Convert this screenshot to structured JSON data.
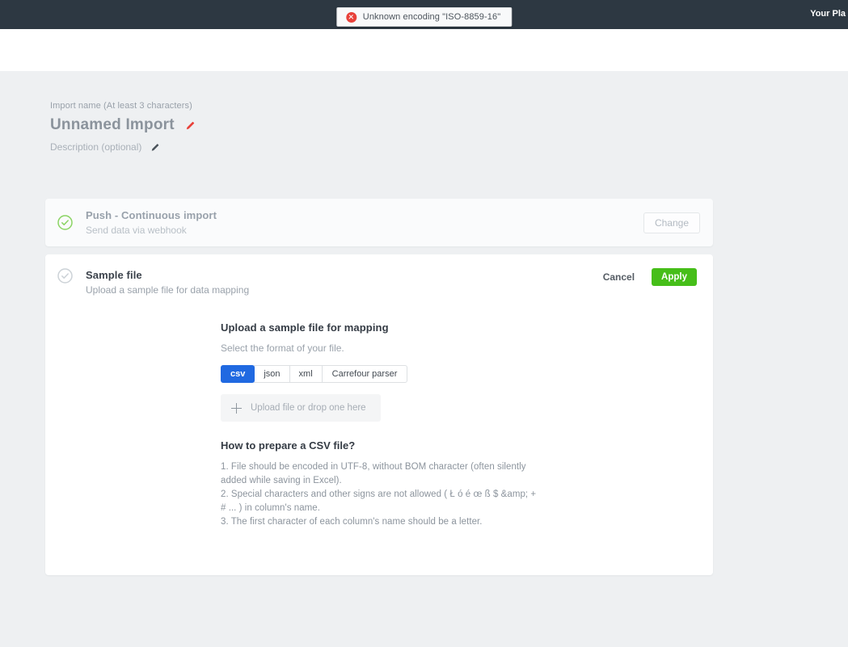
{
  "topbar": {
    "toast": {
      "icon": "error-icon",
      "message": "Unknown encoding \"ISO-8859-16\""
    },
    "plan_label": "Your Pla"
  },
  "import_header": {
    "name_label": "Import name (At least 3 characters)",
    "name_value": "Unnamed Import",
    "description_label": "Description (optional)"
  },
  "steps": {
    "push": {
      "title": "Push - Continuous import",
      "subtitle": "Send data via webhook",
      "change_label": "Change",
      "status_icon": "check-circle-green"
    },
    "sample": {
      "title": "Sample file",
      "subtitle": "Upload a sample file for data mapping",
      "cancel_label": "Cancel",
      "apply_label": "Apply",
      "status_icon": "check-circle-gray"
    }
  },
  "sample_form": {
    "heading": "Upload a sample file for mapping",
    "format_hint": "Select the format of your file.",
    "formats": [
      {
        "label": "csv",
        "selected": true
      },
      {
        "label": "json",
        "selected": false
      },
      {
        "label": "xml",
        "selected": false
      },
      {
        "label": "Carrefour parser",
        "selected": false
      }
    ],
    "upload_label": "Upload file or drop one here",
    "howto_heading": "How to prepare a CSV file?",
    "howto_items": [
      "1. File should be encoded in UTF-8, without BOM character (often silently added while saving in Excel).",
      "2. Special characters and other signs are not allowed ( Ł ó é œ ß $ &amp; + # ... ) in column's name.",
      "3. The first character of each column's name should be a letter."
    ]
  },
  "colors": {
    "topbar_dark": "#2d3842",
    "page_background": "#eef0f2",
    "accent_blue": "#2069e1",
    "apply_green": "#46be19",
    "error_red": "#e8413a",
    "check_green": "#8ad463",
    "check_gray": "#ccd2d7"
  }
}
